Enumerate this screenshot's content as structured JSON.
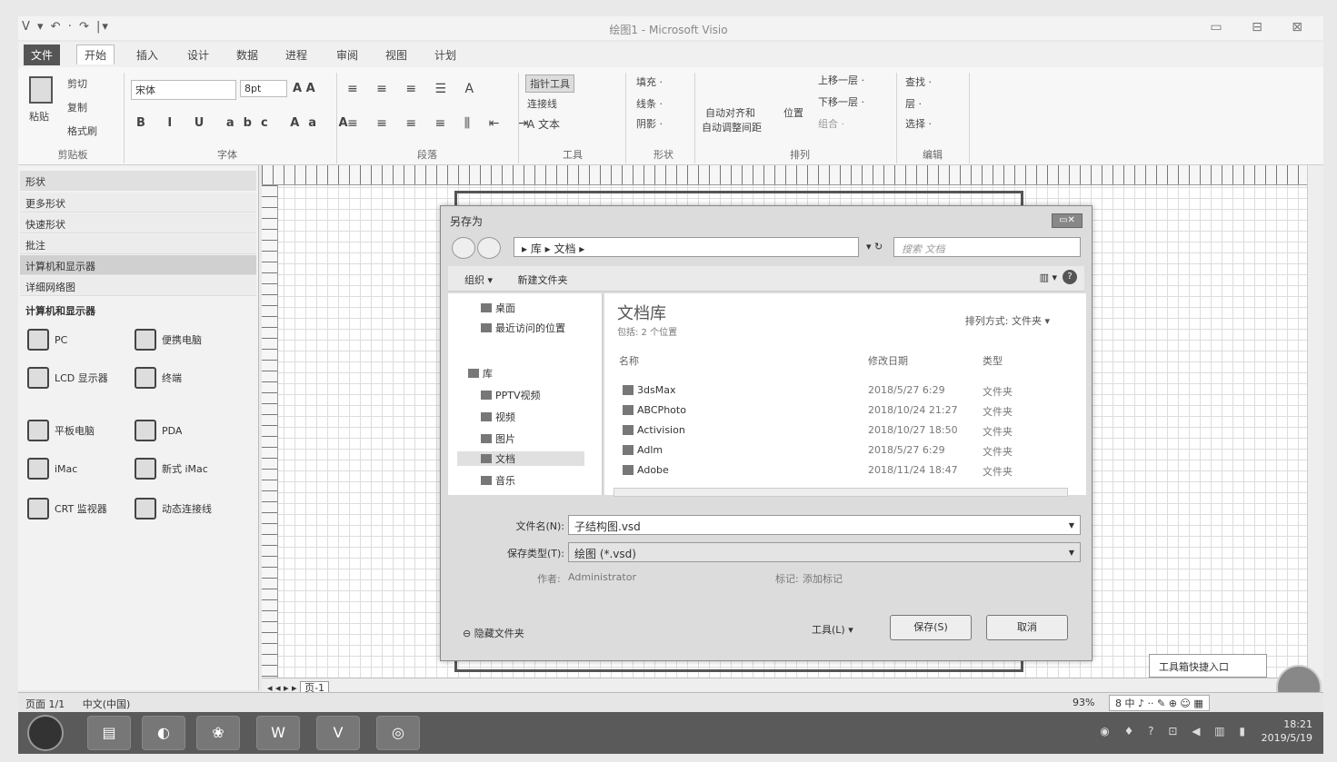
{
  "window": {
    "title": "绘图1 - Microsoft Visio",
    "qat": "V  ▾ ↶ · ↷ |▾",
    "controls": "▭ ⊟ ⊠"
  },
  "tabs": [
    "文件",
    "开始",
    "插入",
    "设计",
    "数据",
    "进程",
    "审阅",
    "视图",
    "计划"
  ],
  "ribbon": {
    "paste": "粘贴",
    "cut": "剪切",
    "copy": "复制",
    "format_painter": "格式刷",
    "clipboard_group": "剪贴板",
    "font_name": "宋体",
    "font_size": "8pt",
    "font_group": "字体",
    "para_group": "段落",
    "pointer_tool": "指针工具",
    "connector": "连接线",
    "text": "A 文本",
    "tools_group": "工具",
    "fill": "填充 ·",
    "line": "线条 ·",
    "shadow": "阴影 ·",
    "shape_group": "形状",
    "auto_align": "自动对齐和",
    "auto_space": "自动调整间距",
    "position": "位置",
    "bring_forward": "上移一层 ·",
    "send_backward": "下移一层 ·",
    "group": "组合 ·",
    "arrange_group": "排列",
    "find": "查找 ·",
    "layers": "层 ·",
    "select": "选择 ·",
    "edit_group": "编辑"
  },
  "shapes_panel": {
    "header": "形状",
    "rows": [
      "更多形状",
      "快速形状",
      "批注",
      "计算机和显示器",
      "详细网络图"
    ],
    "selected_index": 3,
    "stencil_title": "计算机和显示器",
    "stencils": [
      "PC",
      "便携电脑",
      "LCD 显示器",
      "终端",
      "平板电脑",
      "PDA",
      "iMac",
      "新式 iMac",
      "CRT 监视器",
      "动态连接线"
    ]
  },
  "page_tab": "页-1",
  "status": {
    "page": "页面 1/1",
    "lang": "中文(中国)",
    "zoom": "93%",
    "ime": "8 中 ♪ ·· ✎ ⊕ ☺ ▦"
  },
  "tooltip": "工具箱快捷入口",
  "taskbar": {
    "time": "18:21",
    "date": "2019/5/19",
    "apps": [
      "▤",
      "◐",
      "❀",
      "W",
      "V",
      "◎"
    ]
  },
  "dialog": {
    "title": "另存为",
    "close": "▭✕",
    "address": "▸ 库 ▸ 文档 ▸",
    "search_placeholder": "搜索 文档",
    "organize": "组织 ▾",
    "new_folder": "新建文件夹",
    "nav": [
      "桌面",
      "最近访问的位置",
      "库",
      "PPTV视频",
      "视频",
      "图片",
      "文档",
      "音乐"
    ],
    "nav_selected_index": 6,
    "lib_title": "文档库",
    "lib_sub": "包括: 2 个位置",
    "sort_by": "排列方式:  文件夹 ▾",
    "columns": [
      "名称",
      "修改日期",
      "类型"
    ],
    "files": [
      {
        "name": "3dsMax",
        "date": "2018/5/27 6:29",
        "type": "文件夹"
      },
      {
        "name": "ABCPhoto",
        "date": "2018/10/24 21:27",
        "type": "文件夹"
      },
      {
        "name": "Activision",
        "date": "2018/10/27 18:50",
        "type": "文件夹"
      },
      {
        "name": "Adlm",
        "date": "2018/5/27 6:29",
        "type": "文件夹"
      },
      {
        "name": "Adobe",
        "date": "2018/11/24 18:47",
        "type": "文件夹"
      }
    ],
    "filename_label": "文件名(N):",
    "filename_value": "子结构图.vsd",
    "filetype_label": "保存类型(T):",
    "filetype_value": "绘图 (*.vsd)",
    "author_label": "作者:",
    "author_value": "Administrator",
    "tags_label": "标记:",
    "tags_value": "添加标记",
    "hide_folders": "隐藏文件夹",
    "tools": "工具(L)",
    "save": "保存(S)",
    "cancel": "取消"
  }
}
